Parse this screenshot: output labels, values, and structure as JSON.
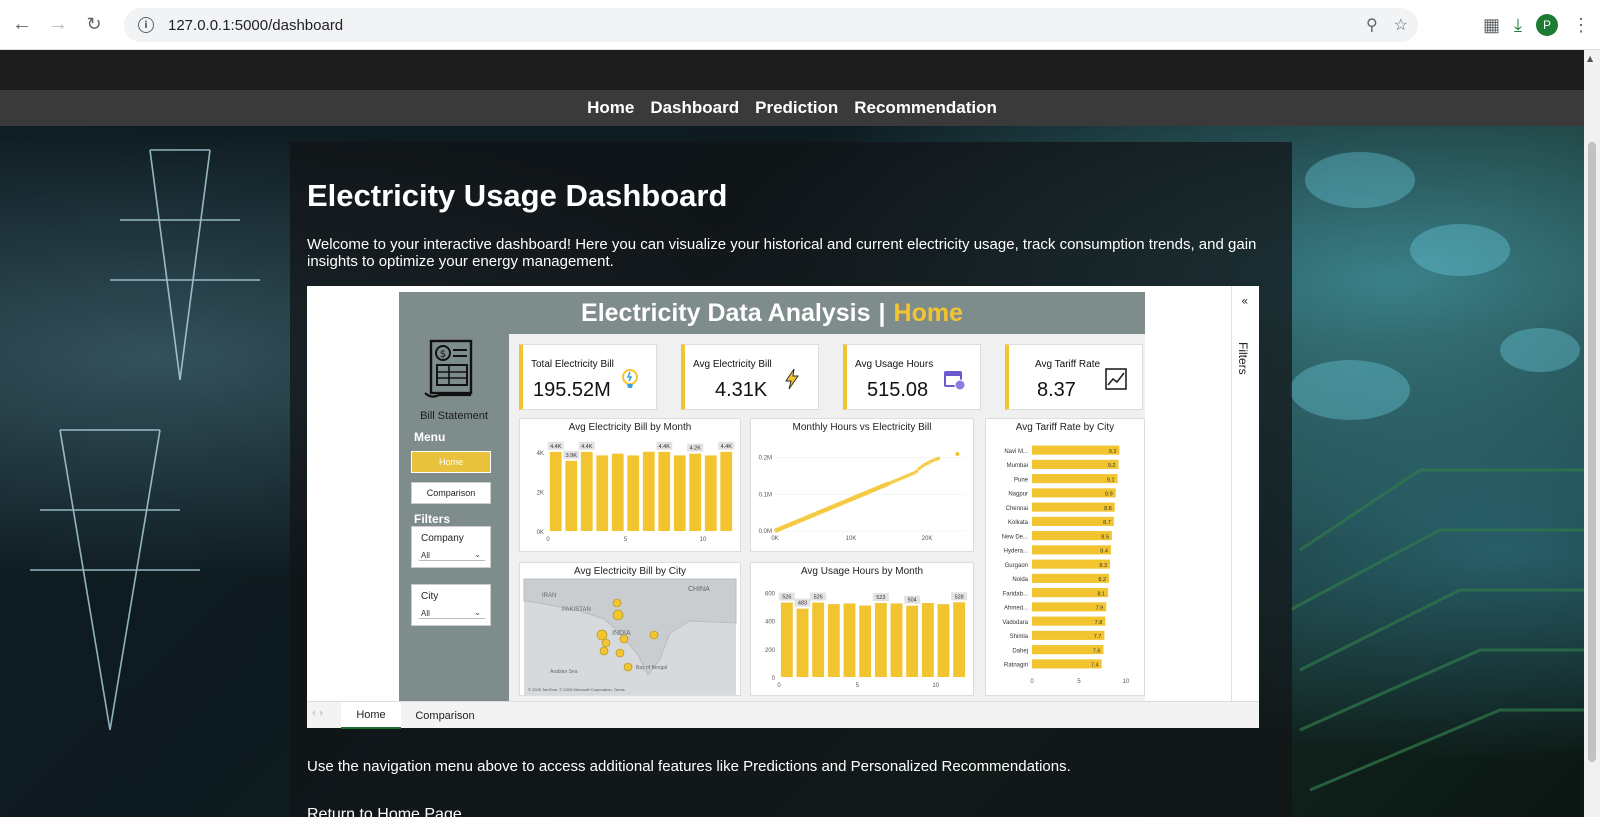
{
  "browser": {
    "url": "127.0.0.1:5000/dashboard",
    "profile_initial": "P"
  },
  "nav": {
    "items": [
      "Home",
      "Dashboard",
      "Prediction",
      "Recommendation"
    ]
  },
  "page": {
    "title": "Electricity Usage Dashboard",
    "intro": "Welcome to your interactive dashboard! Here you can visualize your historical and current electricity usage, track consumption trends, and gain insights to optimize your energy management.",
    "footer_note": "Use the navigation menu above to access additional features like Predictions and Personalized Recommendations.",
    "return_link": "Return to Home Page"
  },
  "report": {
    "title_main": "Electricity Data Analysis",
    "title_sep": "|",
    "title_page": "Home",
    "sidebar": {
      "bill_label": "Bill Statement",
      "menu_label": "Menu",
      "home_button": "Home",
      "comparison_button": "Comparison",
      "filters_label": "Filters",
      "slicers": [
        {
          "title": "Company",
          "value": "All"
        },
        {
          "title": "City",
          "value": "All"
        }
      ]
    },
    "kpis": [
      {
        "label": "Total Electricity Bill",
        "value": "195.52M",
        "icon": "lightbulb-icon"
      },
      {
        "label": "Avg Electricity Bill",
        "value": "4.31K",
        "icon": "lightning-icon"
      },
      {
        "label": "Avg Usage Hours",
        "value": "515.08",
        "icon": "calendar-icon"
      },
      {
        "label": "Avg Tariff Rate",
        "value": "8.37",
        "icon": "rate-chart-icon"
      }
    ],
    "filters_pane_label": "Filters",
    "tabs": [
      "Home",
      "Comparison"
    ],
    "map": {
      "title": "Avg Electricity Bill by City",
      "labels": [
        "IRAN",
        "CHINA",
        "PAKISTAN",
        "INDIA",
        "Arabian Sea",
        "Bay of Bengal"
      ],
      "attribution": "© 2025 TomTom, © 2025 Microsoft Corporation, Terms"
    }
  },
  "chart_data": [
    {
      "type": "bar",
      "title": "Avg Electricity Bill by Month",
      "x": [
        1,
        2,
        3,
        4,
        5,
        6,
        7,
        8,
        9,
        10,
        11,
        12
      ],
      "values": [
        4400,
        3900,
        4400,
        4200,
        4300,
        4200,
        4400,
        4400,
        4200,
        4300,
        4200,
        4400
      ],
      "data_labels": [
        {
          "index": 0,
          "text": "4.4K"
        },
        {
          "index": 1,
          "text": "3.9K"
        },
        {
          "index": 2,
          "text": "4.4K"
        },
        {
          "index": 7,
          "text": "4.4K"
        },
        {
          "index": 9,
          "text": "4.2K"
        },
        {
          "index": 11,
          "text": "4.4K"
        }
      ],
      "yticks": [
        "0K",
        "2K",
        "4K"
      ],
      "xticks": [
        "0",
        "5",
        "10"
      ],
      "ylim": [
        0,
        5000
      ],
      "color": "#f2c530"
    },
    {
      "type": "scatter",
      "title": "Monthly Hours vs Electricity Bill",
      "xticks": [
        "0K",
        "10K",
        "20K"
      ],
      "yticks": [
        "0.0M",
        "0.1M",
        "0.2M"
      ],
      "xlim": [
        0,
        25000
      ],
      "ylim": [
        0,
        0.24
      ],
      "trend": [
        [
          200,
          0.002
        ],
        [
          18500,
          0.16
        ],
        [
          19200,
          0.175
        ],
        [
          20500,
          0.19
        ],
        [
          21500,
          0.198
        ]
      ],
      "outlier": [
        24000,
        0.21
      ],
      "color": "#f2c530"
    },
    {
      "type": "bar",
      "orientation": "horizontal",
      "title": "Avg Tariff Rate by City",
      "categories": [
        "Navi M...",
        "Mumbai",
        "Pune",
        "Nagpur",
        "Chennai",
        "Kolkata",
        "New De...",
        "Hydera...",
        "Gurgaon",
        "Noida",
        "Faridab...",
        "Ahmed...",
        "Vadodara",
        "Shimla",
        "Dahej",
        "Ratnagiri"
      ],
      "values": [
        9.3,
        9.2,
        9.1,
        8.9,
        8.8,
        8.7,
        8.5,
        8.4,
        8.3,
        8.2,
        8.1,
        7.9,
        7.8,
        7.7,
        7.6,
        7.4
      ],
      "xticks": [
        "0",
        "5",
        "10"
      ],
      "xlim": [
        0,
        10
      ],
      "color": "#f2c530"
    },
    {
      "type": "bar",
      "title": "Avg Usage Hours by Month",
      "x": [
        1,
        2,
        3,
        4,
        5,
        6,
        7,
        8,
        9,
        10,
        11,
        12
      ],
      "values": [
        526,
        483,
        526,
        515,
        520,
        505,
        523,
        520,
        504,
        523,
        515,
        528
      ],
      "data_labels": [
        {
          "index": 0,
          "text": "526"
        },
        {
          "index": 1,
          "text": "483"
        },
        {
          "index": 2,
          "text": "526"
        },
        {
          "index": 6,
          "text": "523"
        },
        {
          "index": 8,
          "text": "504"
        },
        {
          "index": 11,
          "text": "528"
        }
      ],
      "yticks": [
        "0",
        "200",
        "400",
        "600"
      ],
      "xticks": [
        "0",
        "5",
        "10"
      ],
      "ylim": [
        0,
        650
      ],
      "color": "#f2c530"
    }
  ]
}
